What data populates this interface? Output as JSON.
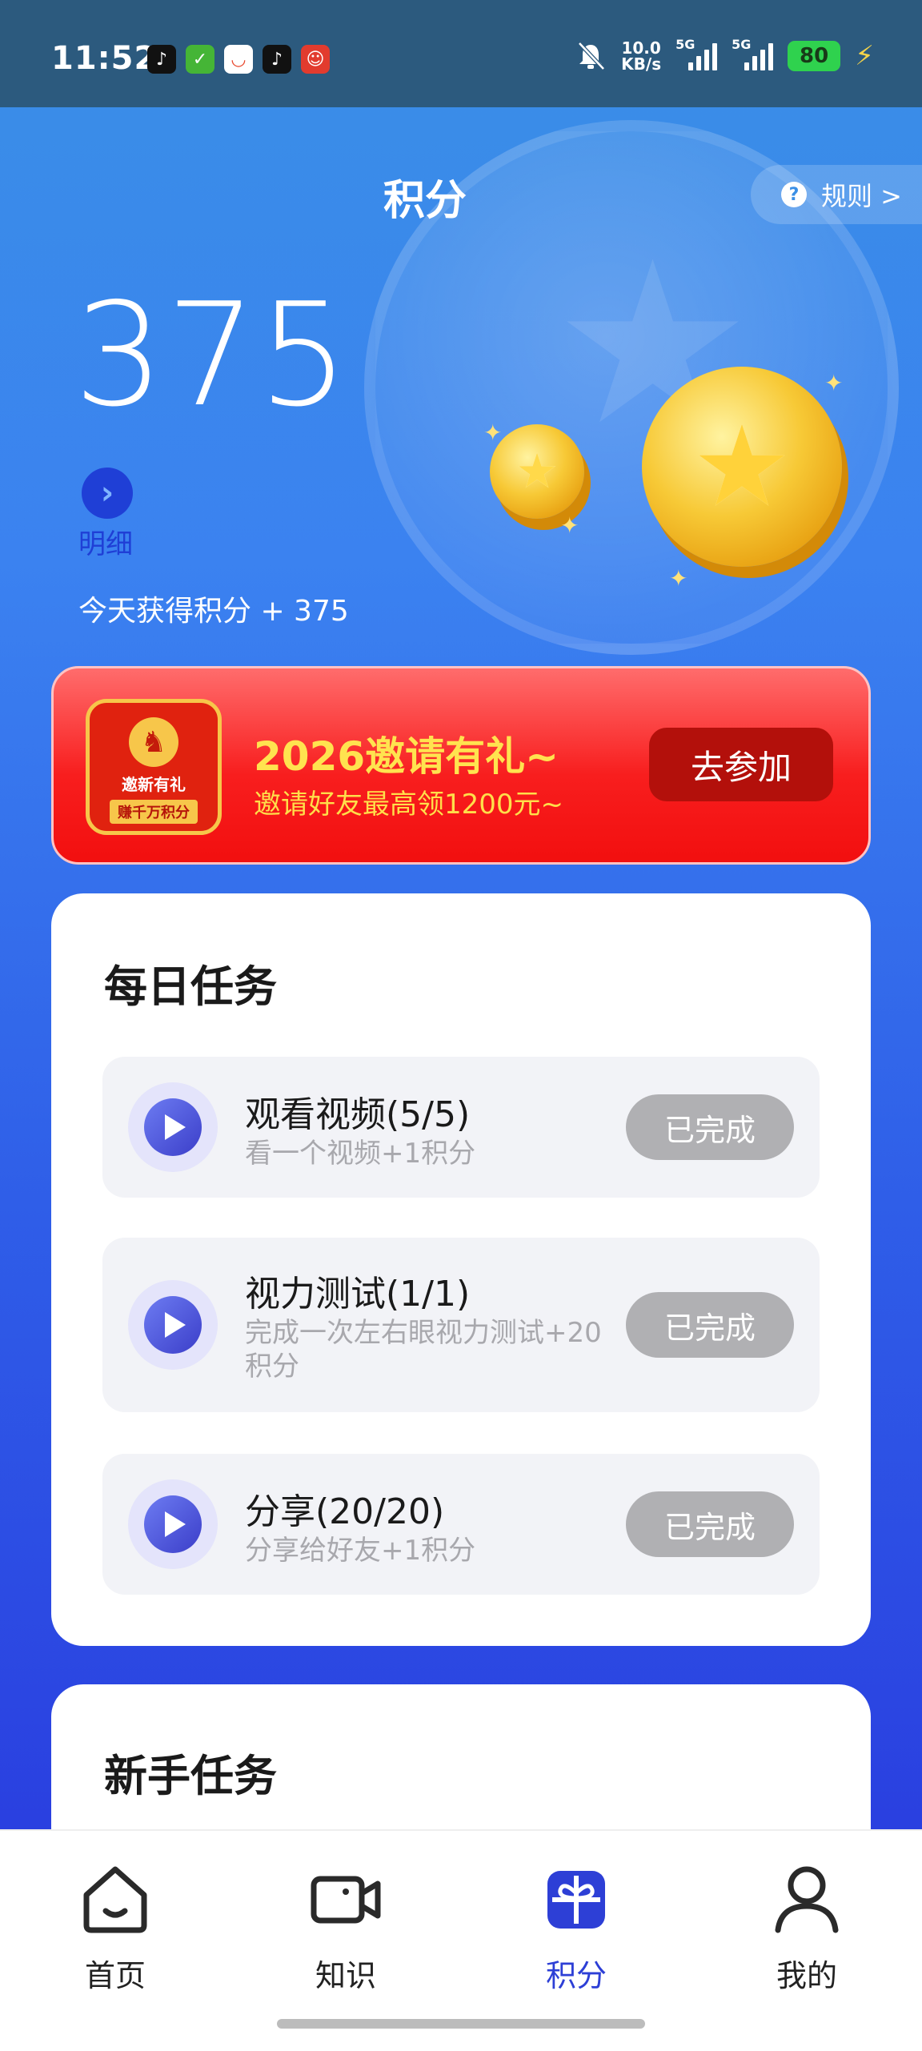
{
  "status_bar": {
    "time": "11:52",
    "net_speed_value": "10.0",
    "net_speed_unit": "KB/s",
    "signal1_label": "5G",
    "signal2_label": "5G",
    "battery": "80"
  },
  "header": {
    "title": "积分",
    "rules_label": "规则 >",
    "points": "375",
    "detail_label": "明细",
    "today_label": "今天获得积分 + 375"
  },
  "invite": {
    "badge_title": "邀新有礼",
    "badge_sub": "赚千万积分",
    "title": "2026邀请有礼~",
    "subtitle": "邀请好友最高领1200元~",
    "button": "去参加"
  },
  "daily": {
    "title": "每日任务",
    "tasks": [
      {
        "name": "观看视频(5/5)",
        "desc": "看一个视频+1积分",
        "button": "已完成"
      },
      {
        "name": "视力测试(1/1)",
        "desc": "完成一次左右眼视力测试+20积分",
        "button": "已完成"
      },
      {
        "name": "分享(20/20)",
        "desc": "分享给好友+1积分",
        "button": "已完成"
      }
    ]
  },
  "newbie": {
    "title": "新手任务"
  },
  "nav": {
    "items": [
      {
        "label": "首页",
        "icon": "home-icon"
      },
      {
        "label": "知识",
        "icon": "video-camera-icon"
      },
      {
        "label": "积分",
        "icon": "gift-icon",
        "active": true
      },
      {
        "label": "我的",
        "icon": "user-icon"
      }
    ],
    "active_color": "#2d3fd6"
  }
}
